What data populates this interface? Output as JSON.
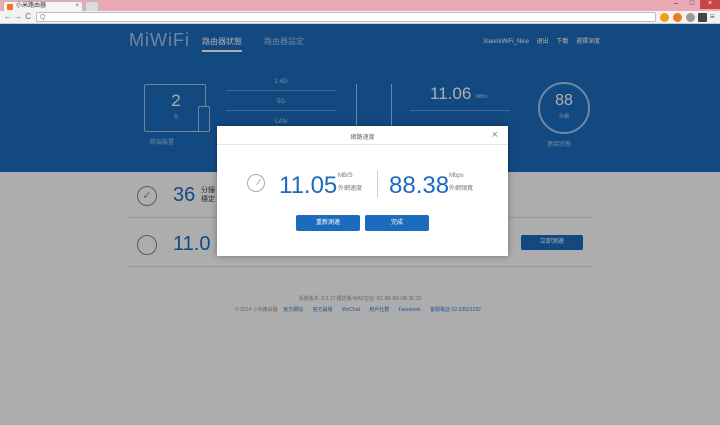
{
  "browser": {
    "tab_title": "小米路由器",
    "tab_close": "×",
    "win_min": "–",
    "win_max": "□",
    "win_close": "×",
    "nav_back": "←",
    "nav_forward": "→",
    "nav_reload": "C",
    "omnibox_icon": "Q",
    "menu_icon": "≡"
  },
  "header": {
    "logo": "MiWiFi",
    "nav_status": "路由器狀態",
    "nav_settings": "路由器設定",
    "wifi_name": "XiaomiWiFi_Nice",
    "logout": "退出",
    "download": "下載",
    "app_download": "選擇深度"
  },
  "dashboard": {
    "devices_count": "2",
    "devices_unit": "台",
    "devices_label": "終端裝置",
    "band_24": "2.4G",
    "band_5": "5G",
    "band_lan": "LAN",
    "current_speed": "11.06",
    "current_speed_unit": "MB/s",
    "score": "88",
    "score_unit": "外網",
    "score_label": "連接狀態"
  },
  "panels": {
    "uptime_value": "36",
    "uptime_unit_line1": "分鐘",
    "uptime_unit_line2": "穩定",
    "speed_value": "11.0",
    "retest_button": "立即測速"
  },
  "footer": {
    "line1": "系統版本: 0.3.17 穩定版  MAC位址: 8C:BE:BE:0B:3E:33",
    "copyright": "© 2014 小米路由器",
    "links": [
      "官方網站",
      "官方論壇",
      "WeChat",
      "用戶社群",
      "Facebook",
      "客服電話 02-23521232"
    ]
  },
  "modal": {
    "title": "網路速度",
    "close": "×",
    "download_value": "11.05",
    "download_unit": "MB/S",
    "download_label": "外網速度",
    "bandwidth_value": "88.38",
    "bandwidth_unit": "Mbps",
    "bandwidth_label": "外網頻寬",
    "retest_button": "重新測速",
    "done_button": "完成"
  }
}
